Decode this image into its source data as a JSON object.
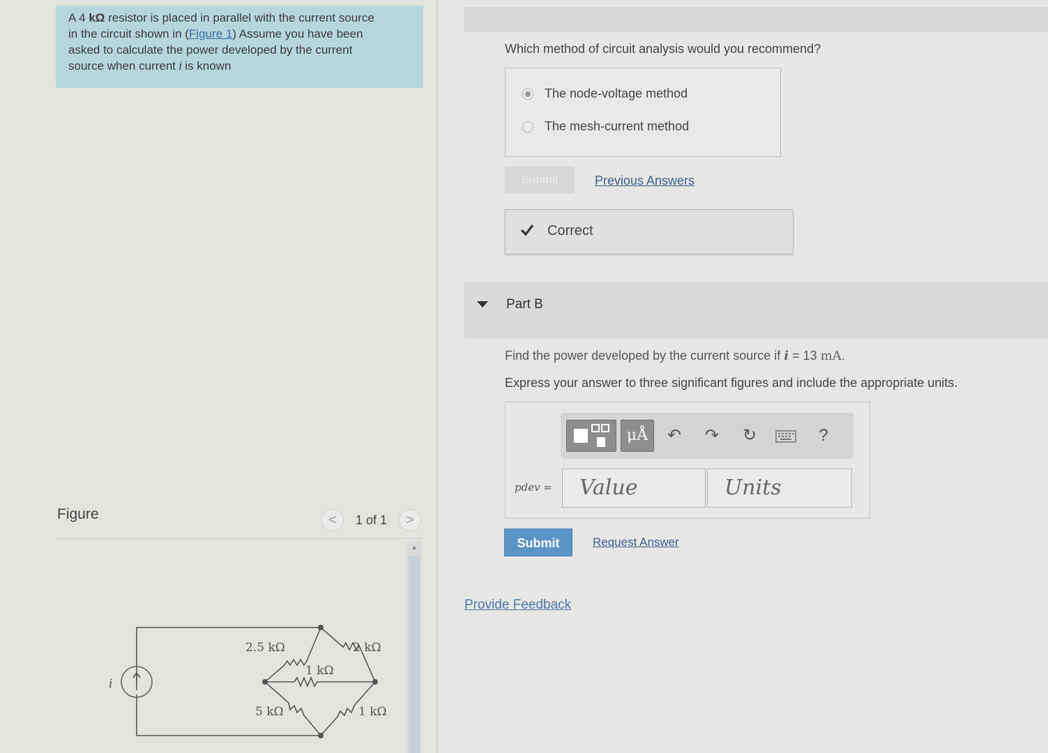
{
  "problem": {
    "line1_pre": "A 4 ",
    "line1_unit": "kΩ",
    "line1_post": " resistor is placed in parallel with the current source",
    "line2_pre": "in the circuit shown in (",
    "line2_link": "Figure 1",
    "line2_post": ") Assume you have been",
    "line3": "asked to calculate the power developed by the current",
    "line4_pre": "source when current ",
    "line4_var": "i",
    "line4_post": " is known"
  },
  "figure": {
    "label": "Figure",
    "page_indicator": "1 of 1",
    "prev_glyph": "<",
    "next_glyph": ">",
    "circuit": {
      "source_label": "i",
      "r_top_left": "2.5 kΩ",
      "r_top_right": "2 kΩ",
      "r_middle": "1 kΩ",
      "r_bottom_left": "5 kΩ",
      "r_bottom_right": "1 kΩ"
    }
  },
  "part_a": {
    "question": "Which method of circuit analysis would you recommend?",
    "options": [
      {
        "label": "The node-voltage method",
        "selected": true
      },
      {
        "label": "The mesh-current method",
        "selected": false
      }
    ],
    "submit_label": "Submit",
    "previous_answers_label": "Previous Answers",
    "feedback_label": "Correct"
  },
  "part_b": {
    "title": "Part B",
    "find_pre": "Find the power developed by the current source if ",
    "find_var": "i",
    "find_eq": " = 13 ",
    "find_unit": "mA",
    "find_end": ".",
    "instruction": "Express your answer to three significant figures and include the appropriate units.",
    "answer_label": "pdev =",
    "value_placeholder": "Value",
    "units_placeholder": "Units",
    "toolbar": {
      "units_button": "μÅ",
      "help": "?",
      "icons": [
        "template-icon",
        "units-icon",
        "undo-icon",
        "redo-icon",
        "reset-icon",
        "keyboard-icon",
        "help-icon"
      ]
    },
    "submit_label": "Submit",
    "request_answer_label": "Request Answer"
  },
  "provide_feedback_label": "Provide Feedback",
  "colors": {
    "problem_bg": "#b6d6dc",
    "submit_bg": "#5a93c5",
    "link": "#3d5e8c"
  }
}
